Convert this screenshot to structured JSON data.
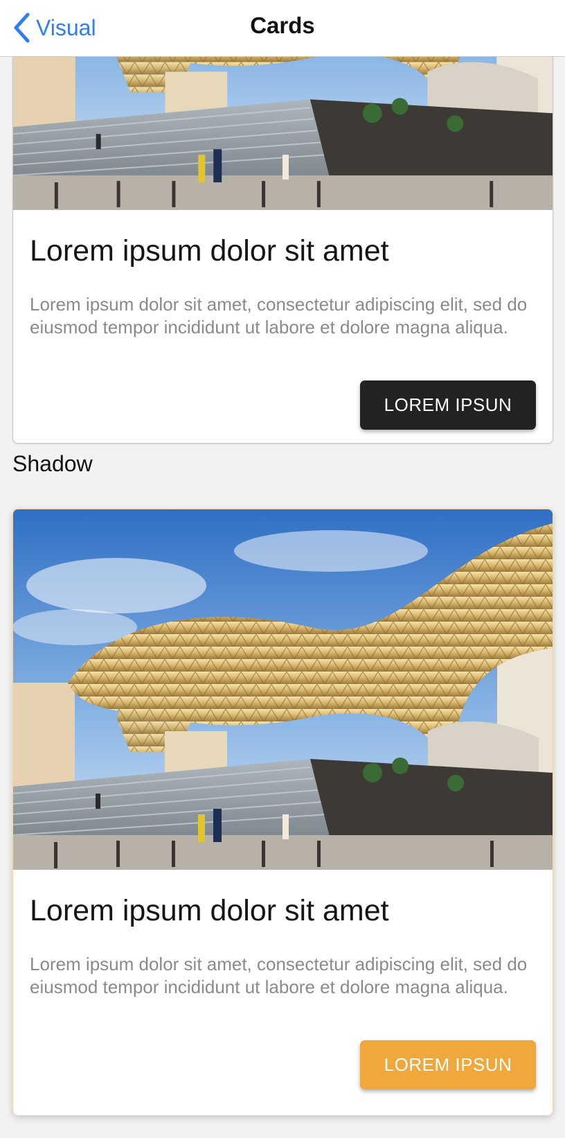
{
  "nav": {
    "back_label": "Visual",
    "title": "Cards"
  },
  "cards": [
    {
      "title": "Lorem ipsum dolor sit amet",
      "text": "Lorem ipsum dolor sit amet, consectetur adipiscing elit, sed do eiusmod tempor incididunt ut labore et dolore magna aliqua.",
      "button_label": "LOREM IPSUN",
      "button_color": "#222222"
    },
    {
      "title": "Lorem ipsum dolor sit amet",
      "text": "Lorem ipsum dolor sit amet, consectetur adipiscing elit, sed do eiusmod tempor incididunt ut labore et dolore magna aliqua.",
      "button_label": "LOREM IPSUN",
      "button_color": "#f0a83c"
    }
  ],
  "sections": {
    "shadow_label": "Shadow"
  },
  "colors": {
    "accent": "#2f7df6",
    "text_secondary": "#8a8a8a"
  }
}
